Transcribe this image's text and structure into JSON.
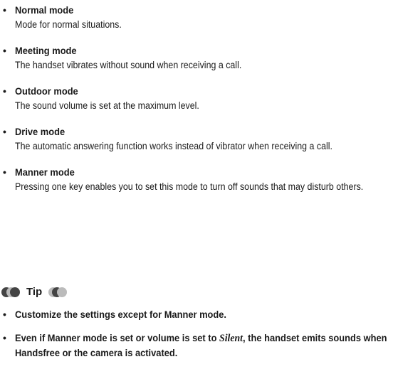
{
  "modes": [
    {
      "title": "Normal mode",
      "description": "Mode for normal situations."
    },
    {
      "title": "Meeting mode",
      "description": "The handset vibrates without sound when receiving a call."
    },
    {
      "title": "Outdoor mode",
      "description": "The sound volume is set at the maximum level."
    },
    {
      "title": "Drive mode",
      "description": "The automatic answering function works instead of vibrator when receiving a call."
    },
    {
      "title": "Manner mode",
      "description": "Pressing one key enables you to set this mode to turn off sounds that may disturb others."
    }
  ],
  "bullet_char": "•",
  "tip": {
    "label": "Tip",
    "colors": {
      "dark": "#444444",
      "light": "#bbbbbb"
    },
    "items": [
      {
        "text": "Customize the settings except for Manner mode."
      },
      {
        "text_before": "Even if Manner mode is set or volume is set to ",
        "emphasis": "Silent",
        "text_after": ", the handset emits sounds when Handsfree or the camera is activated."
      }
    ]
  }
}
